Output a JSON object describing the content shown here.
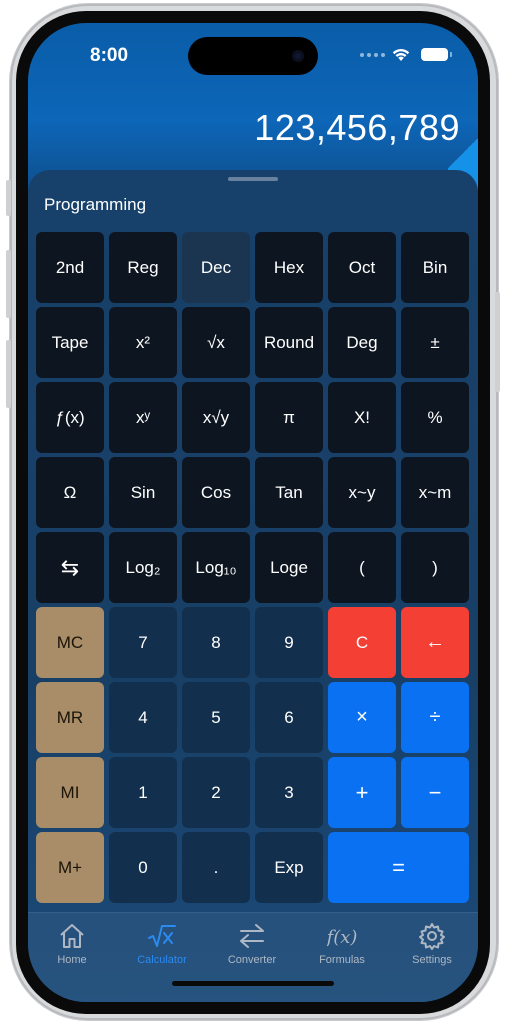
{
  "status_bar": {
    "time": "8:00"
  },
  "display": {
    "value": "123,456,789"
  },
  "sheet": {
    "mode_label": "Programming"
  },
  "keypad": {
    "rows": [
      [
        "2nd",
        "Reg",
        "Dec",
        "Hex",
        "Oct",
        "Bin"
      ],
      [
        "Tape",
        "x²",
        "√x",
        "Round",
        "Deg",
        "±"
      ],
      [
        "ƒ(x)",
        "xʸ",
        "x√y",
        "π",
        "X!",
        "%"
      ],
      [
        "Ω",
        "Sin",
        "Cos",
        "Tan",
        "x~y",
        "x~m"
      ],
      [
        "⇆",
        "Log₂",
        "Log₁₀",
        "Loge",
        "(",
        ")"
      ],
      [
        "MC",
        "7",
        "8",
        "9",
        "C",
        "←"
      ],
      [
        "MR",
        "4",
        "5",
        "6",
        "×",
        "÷"
      ],
      [
        "MI",
        "1",
        "2",
        "3",
        "+",
        "−"
      ],
      [
        "M+",
        "0",
        ".",
        "Exp",
        "="
      ]
    ],
    "selected_base": "Dec"
  },
  "tabs": [
    {
      "label": "Home",
      "icon": "house-icon",
      "active": false
    },
    {
      "label": "Calculator",
      "icon": "square-root-icon",
      "active": true
    },
    {
      "label": "Converter",
      "icon": "arrows-swap-icon",
      "active": false
    },
    {
      "label": "Formulas",
      "icon": "function-icon",
      "active": false
    },
    {
      "label": "Settings",
      "icon": "gear-icon",
      "active": false
    }
  ],
  "colors": {
    "memory_key": "#a88d68",
    "clear_key": "#f43f34",
    "operator_key": "#0a72f2",
    "active_tab": "#2b8bf2"
  }
}
